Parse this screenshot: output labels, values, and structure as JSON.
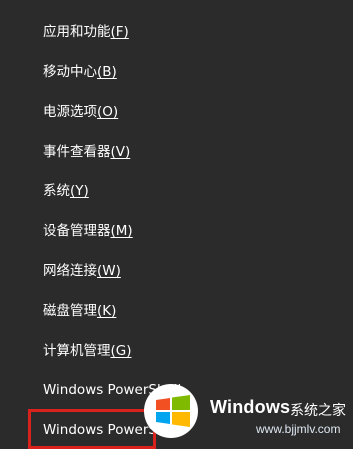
{
  "menu": {
    "items": [
      {
        "label": "应用和功能",
        "accel": "(F)"
      },
      {
        "label": "移动中心",
        "accel": "(B)"
      },
      {
        "label": "电源选项",
        "accel": "(O)"
      },
      {
        "label": "事件查看器",
        "accel": "(V)"
      },
      {
        "label": "系统",
        "accel": "(Y)"
      },
      {
        "label": "设备管理器",
        "accel": "(M)"
      },
      {
        "label": "网络连接",
        "accel": "(W)"
      },
      {
        "label": "磁盘管理",
        "accel": "(K)"
      },
      {
        "label": "计算机管理",
        "accel": "(G)"
      },
      {
        "label": "Windows PowerShell",
        "accel": ""
      },
      {
        "label": "Windows PowerShell",
        "accel": ""
      }
    ]
  },
  "highlight": {
    "color": "#d9221c"
  },
  "watermark": {
    "brand": "Windows",
    "brand_suffix": "系统之家",
    "url": "www.bjjmlv.com",
    "icon": "windows-logo-icon"
  },
  "colors": {
    "background": "#2b2b2b",
    "text": "#ffffff"
  }
}
